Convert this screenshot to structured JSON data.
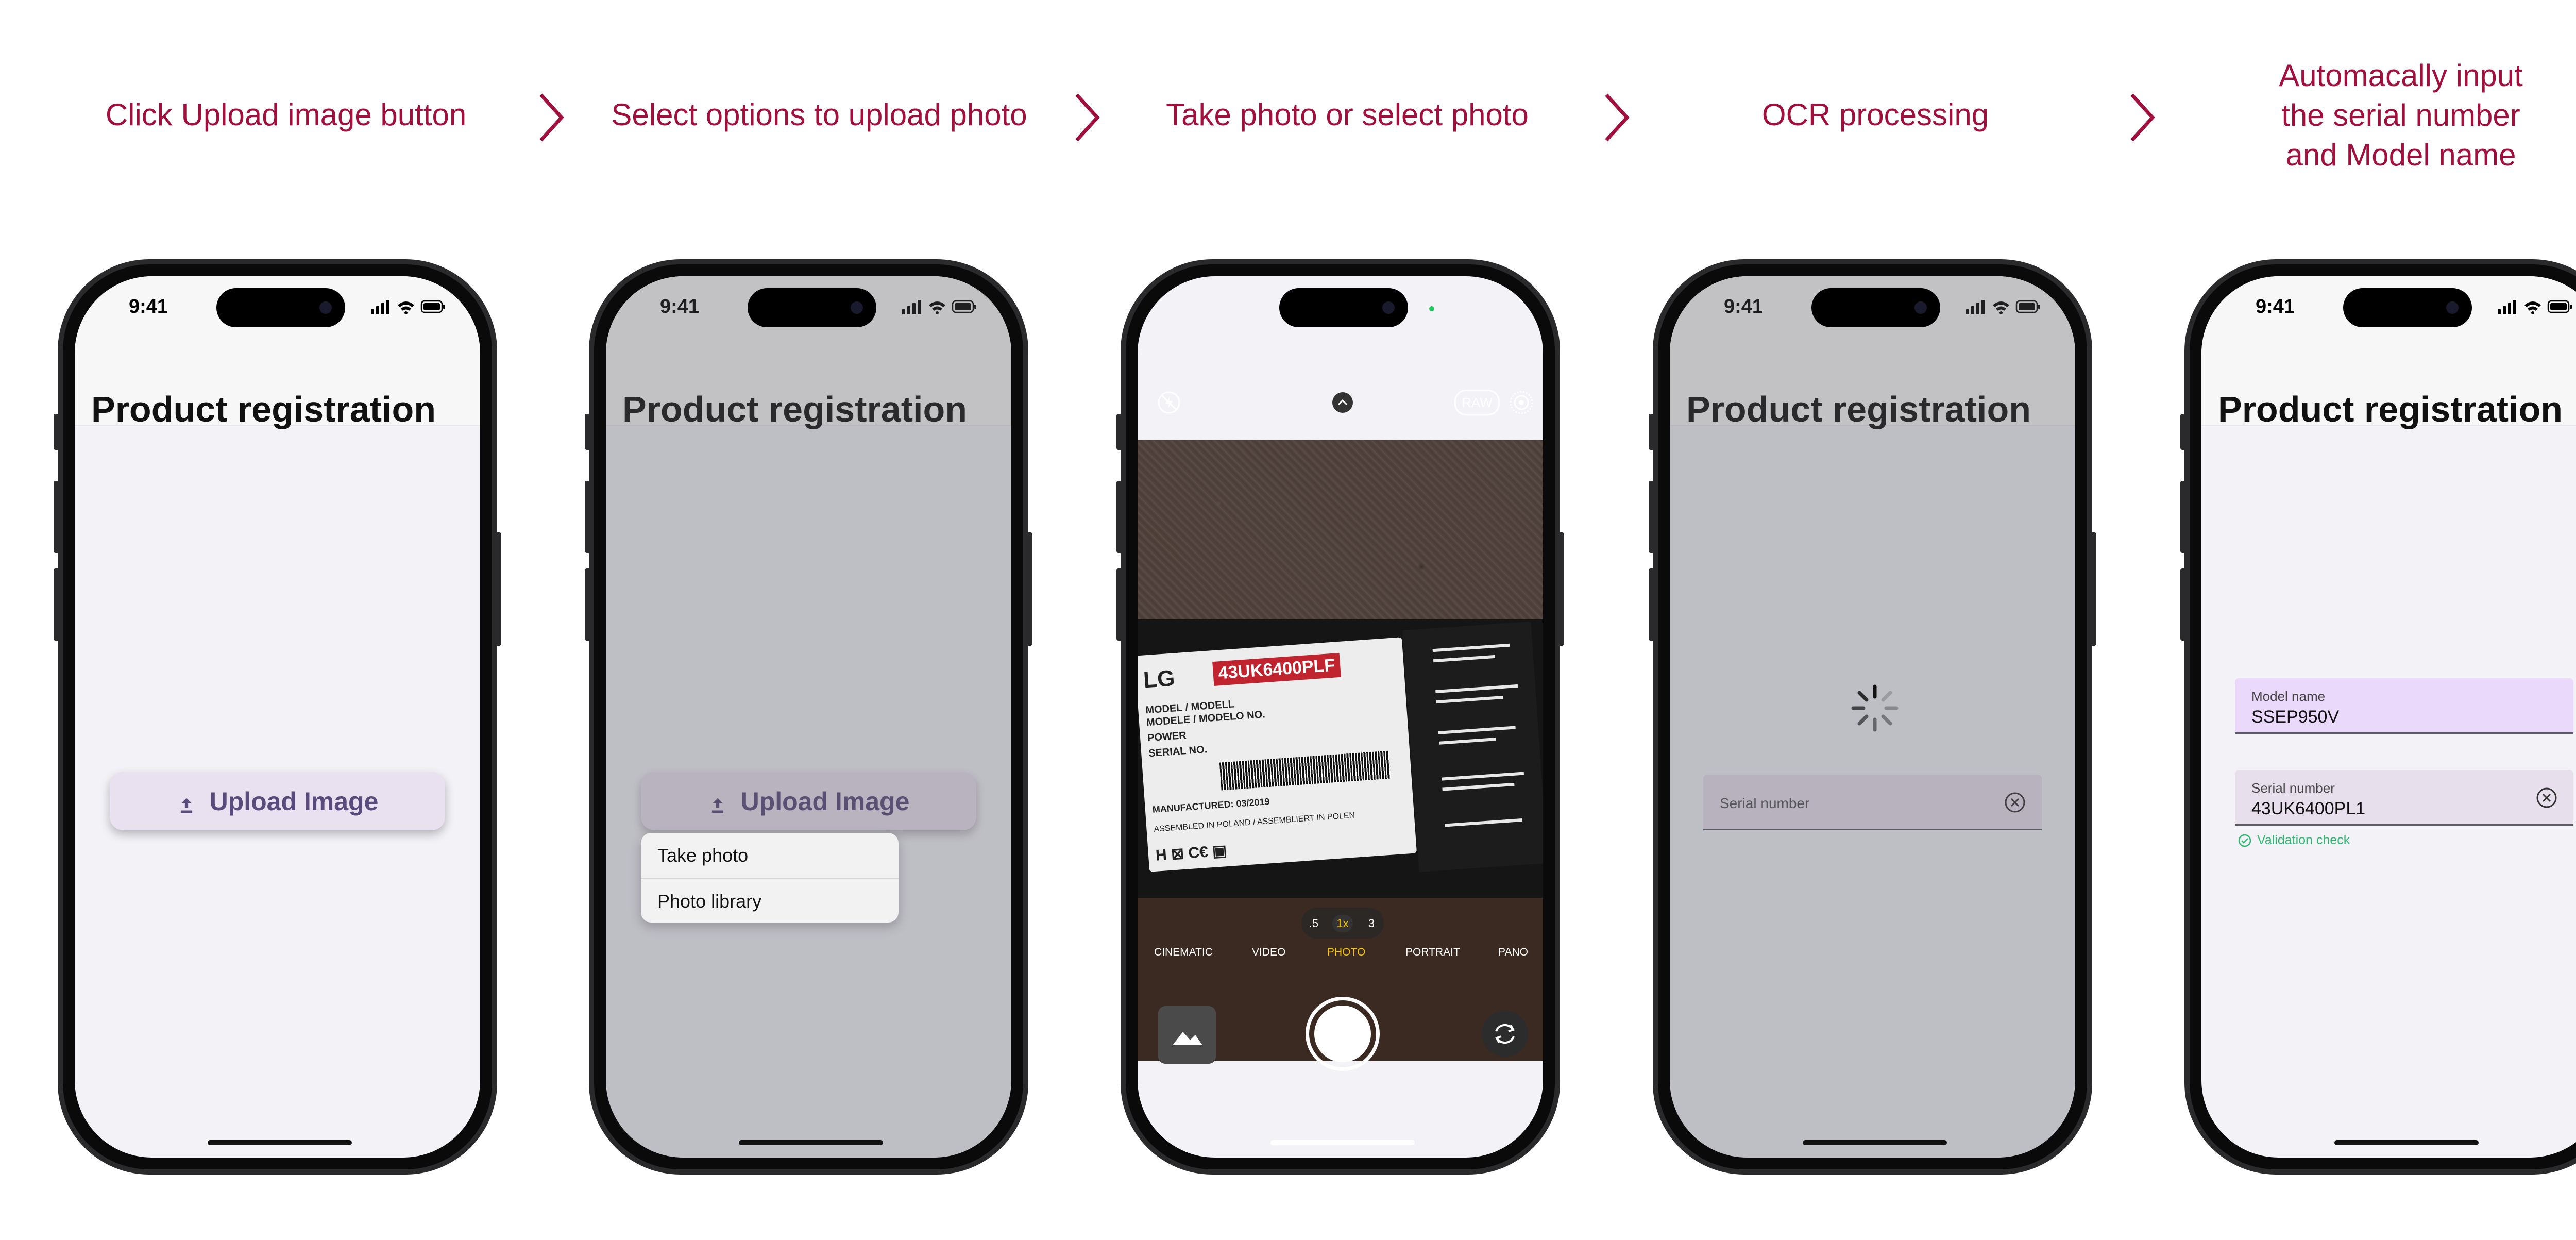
{
  "steps": [
    {
      "label": "Click Upload  image button"
    },
    {
      "label": "Select options to upload photo"
    },
    {
      "label": "Take photo or select photo"
    },
    {
      "label": "OCR  processing"
    },
    {
      "label": "Automacally input\nthe serial number\nand Model name"
    }
  ],
  "status": {
    "time": "9:41"
  },
  "app": {
    "title": "Product registration",
    "upload_label": "Upload Image"
  },
  "menu": {
    "items": [
      "Take photo",
      "Photo library"
    ]
  },
  "ocr": {
    "serial_placeholder": "Serial number"
  },
  "result": {
    "model_label": "Model name",
    "model_value": "SSEP950V",
    "serial_label": "Serial number",
    "serial_value": "43UK6400PL1",
    "validation": "Validation check"
  },
  "camera": {
    "raw": "RAW",
    "zoom": [
      ".5",
      "1x",
      "3"
    ],
    "modes": [
      "CINEMATIC",
      "VIDEO",
      "PHOTO",
      "PORTRAIT",
      "PANO"
    ],
    "active_mode": "PHOTO",
    "label_brand": "LG",
    "label_model": "43UK6400PLF",
    "label_manufactured": "MANUFACTURED: 03/2019",
    "label_origin": "ASSEMBLED IN POLAND / ASSEMBLIERT IN POLEN"
  },
  "colors": {
    "accent": "#a0103d",
    "button_text": "#5a4b7d",
    "button_bg": "#e9e1ef",
    "validation": "#2fb872",
    "camera_highlight": "#f5c400"
  }
}
